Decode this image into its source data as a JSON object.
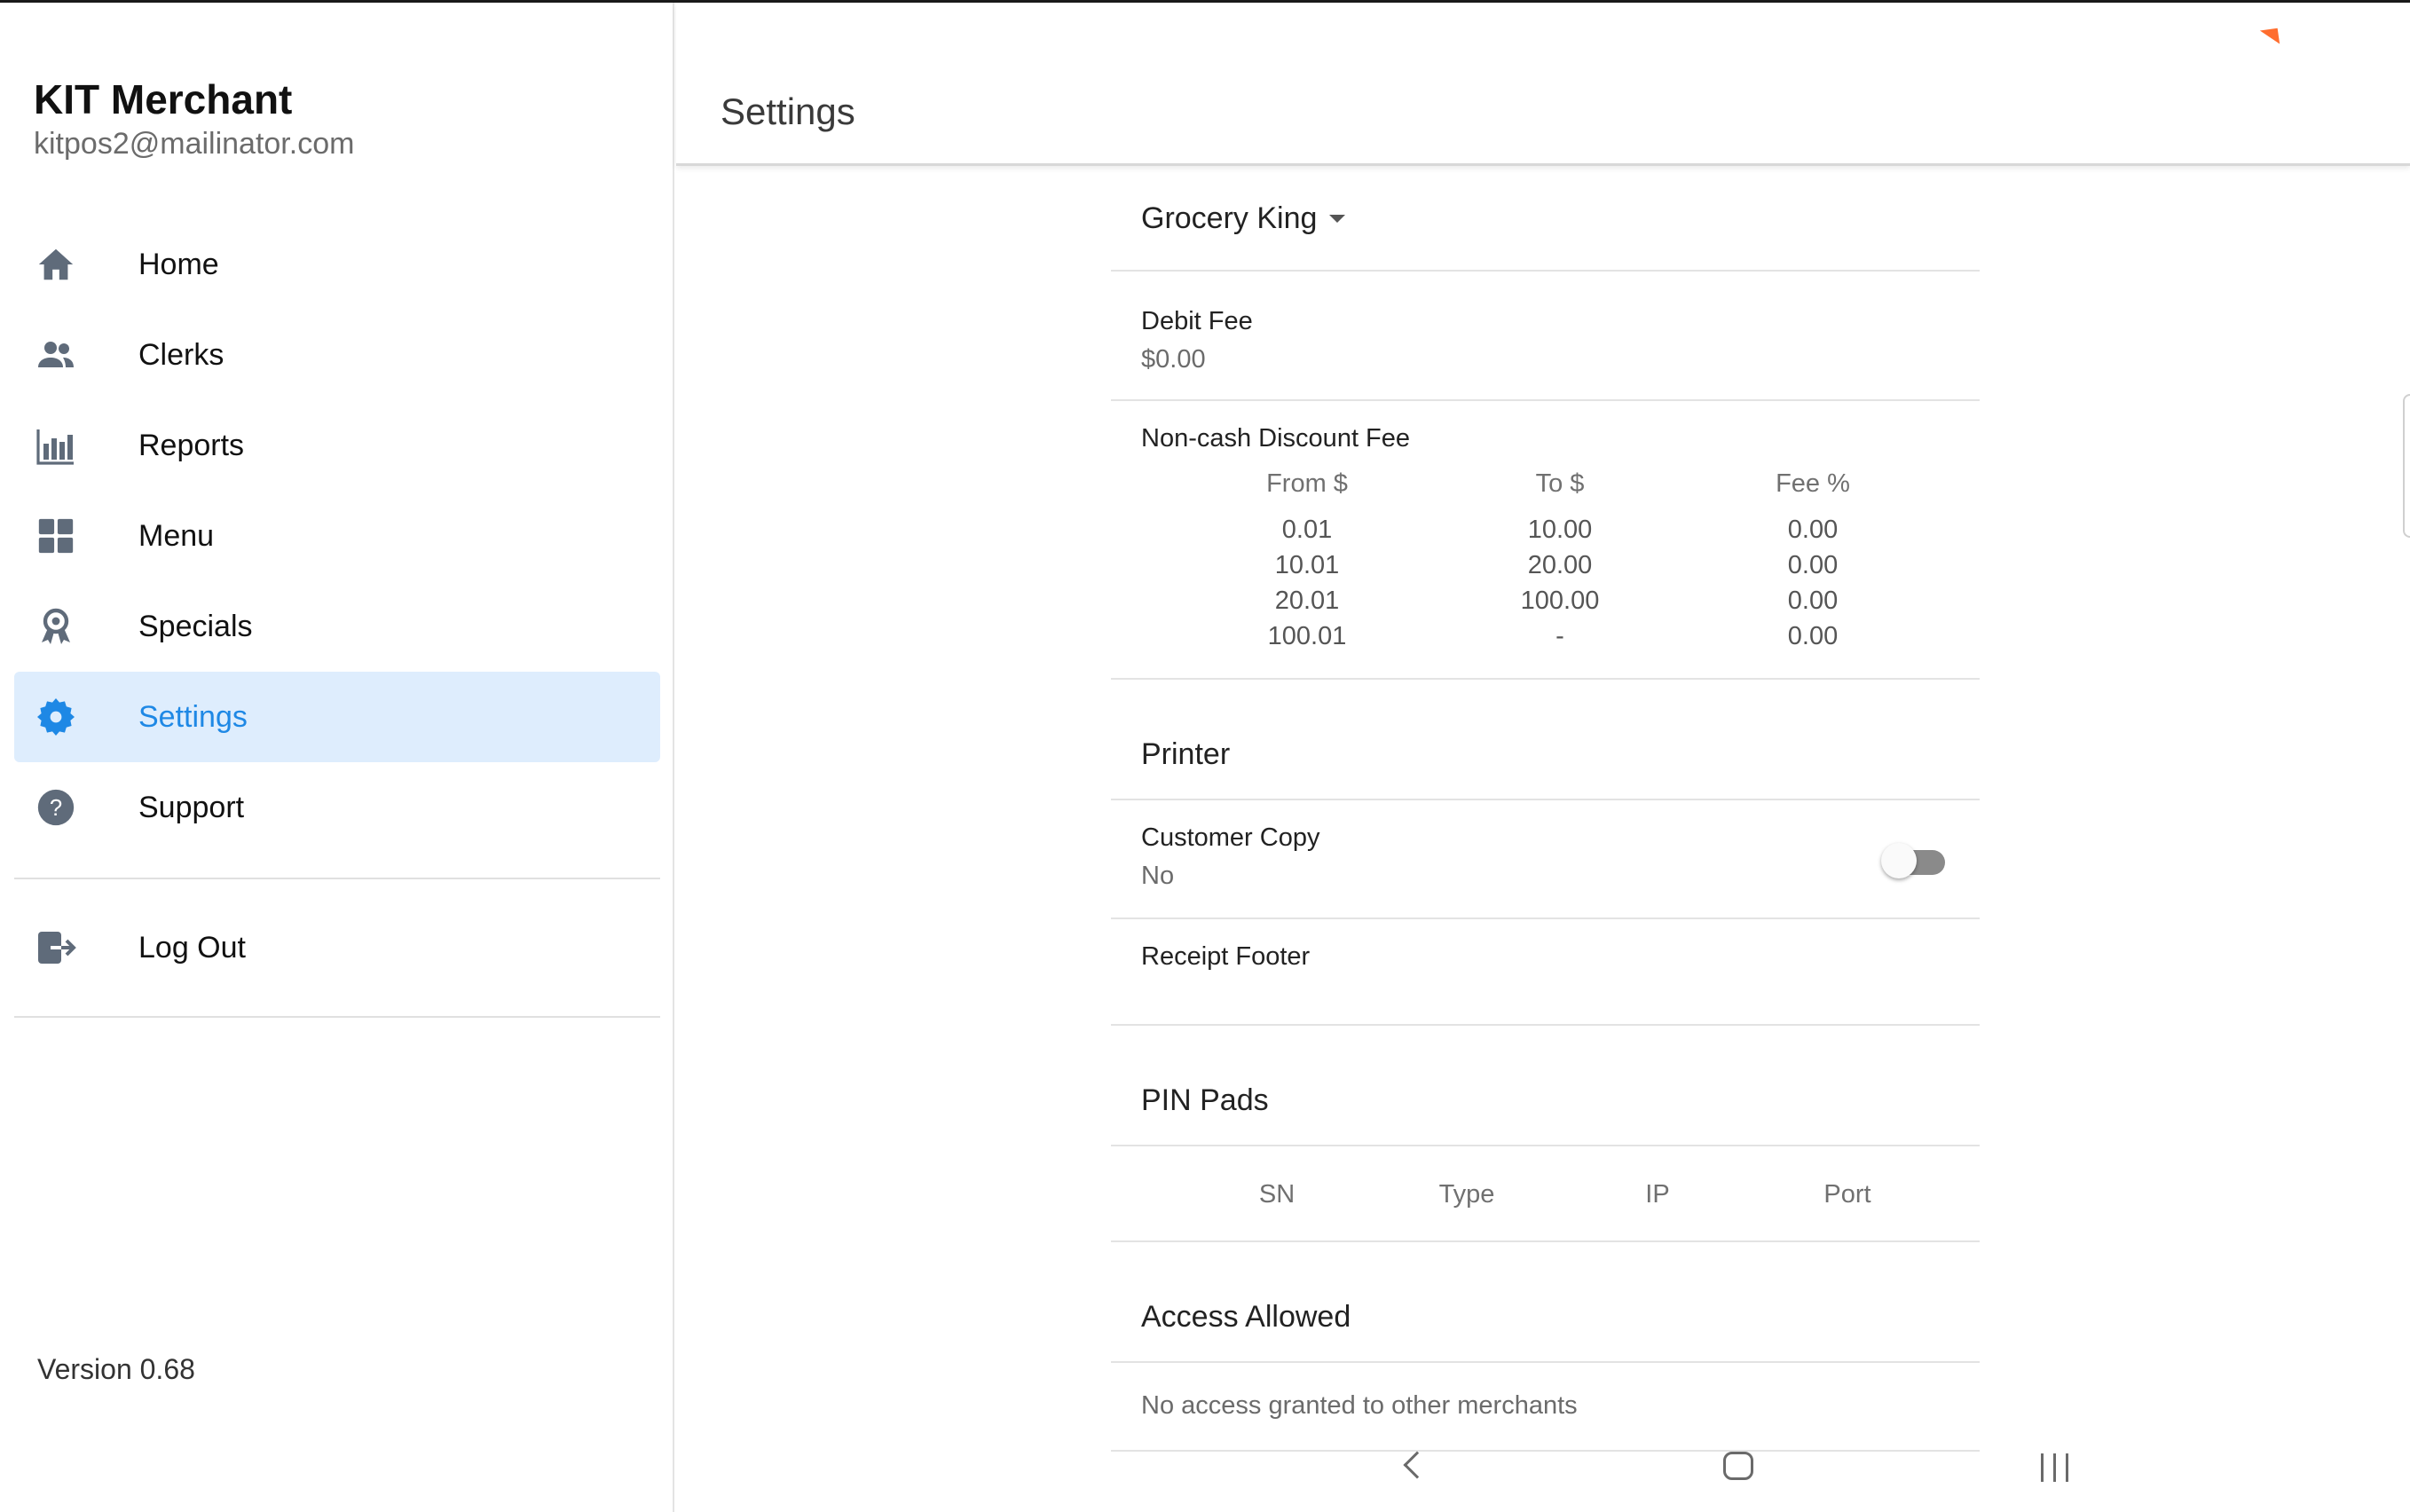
{
  "sidebar": {
    "app_title": "KIT Merchant",
    "email": "kitpos2@mailinator.com",
    "items": [
      {
        "label": "Home",
        "icon": "home-icon"
      },
      {
        "label": "Clerks",
        "icon": "people-icon"
      },
      {
        "label": "Reports",
        "icon": "bar-chart-icon"
      },
      {
        "label": "Menu",
        "icon": "grid-icon"
      },
      {
        "label": "Specials",
        "icon": "award-icon"
      },
      {
        "label": "Settings",
        "icon": "gear-icon",
        "active": true
      },
      {
        "label": "Support",
        "icon": "help-icon"
      }
    ],
    "logout": {
      "label": "Log Out",
      "icon": "logout-icon"
    },
    "version": "Version 0.68"
  },
  "header": {
    "title": "Settings"
  },
  "settings": {
    "store": "Grocery King",
    "debit_fee": {
      "label": "Debit Fee",
      "value": "$0.00"
    },
    "noncash": {
      "label": "Non-cash Discount Fee",
      "columns": [
        "From $",
        "To $",
        "Fee %"
      ],
      "rows": [
        [
          "0.01",
          "10.00",
          "0.00"
        ],
        [
          "10.01",
          "20.00",
          "0.00"
        ],
        [
          "20.01",
          "100.00",
          "0.00"
        ],
        [
          "100.01",
          "-",
          "0.00"
        ]
      ]
    },
    "printer": {
      "title": "Printer",
      "customer_copy": {
        "label": "Customer Copy",
        "value": "No",
        "enabled": false
      },
      "receipt_footer": {
        "label": "Receipt Footer",
        "value": ""
      }
    },
    "pin_pads": {
      "title": "PIN Pads",
      "columns": [
        "SN",
        "Type",
        "IP",
        "Port"
      ]
    },
    "access": {
      "title": "Access Allowed",
      "text": "No access granted to other merchants"
    }
  },
  "colors": {
    "accent": "#1e88e5",
    "active_bg": "#deedfd",
    "icon": "#5f6b7a"
  }
}
